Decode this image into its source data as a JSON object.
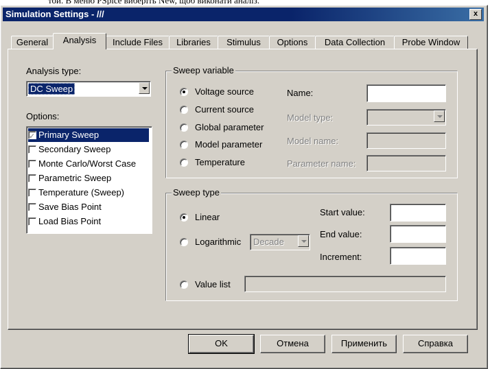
{
  "window": {
    "title": "Simulation Settings - ///",
    "close_label": "x"
  },
  "tabs": [
    {
      "label": "General"
    },
    {
      "label": "Analysis",
      "active": true
    },
    {
      "label": "Include Files"
    },
    {
      "label": "Libraries"
    },
    {
      "label": "Stimulus"
    },
    {
      "label": "Options"
    },
    {
      "label": "Data Collection"
    },
    {
      "label": "Probe Window"
    }
  ],
  "analysis_type": {
    "label": "Analysis type:",
    "value": "DC Sweep"
  },
  "options": {
    "label": "Options:",
    "items": [
      {
        "label": "Primary Sweep",
        "checked": true,
        "selected": true
      },
      {
        "label": "Secondary Sweep",
        "checked": false
      },
      {
        "label": "Monte Carlo/Worst Case",
        "checked": false
      },
      {
        "label": "Parametric Sweep",
        "checked": false
      },
      {
        "label": "Temperature (Sweep)",
        "checked": false
      },
      {
        "label": "Save Bias Point",
        "checked": false
      },
      {
        "label": "Load Bias Point",
        "checked": false
      }
    ]
  },
  "sweep_variable": {
    "title": "Sweep variable",
    "options": [
      {
        "label": "Voltage source",
        "checked": true
      },
      {
        "label": "Current source",
        "checked": false
      },
      {
        "label": "Global parameter",
        "checked": false
      },
      {
        "label": "Model parameter",
        "checked": false
      },
      {
        "label": "Temperature",
        "checked": false
      }
    ],
    "fields": {
      "name_label": "Name:",
      "model_type_label": "Model type:",
      "model_name_label": "Model name:",
      "parameter_name_label": "Parameter name:"
    }
  },
  "sweep_type": {
    "title": "Sweep type",
    "linear_label": "Linear",
    "logarithmic_label": "Logarithmic",
    "log_option": "Decade",
    "value_list_label": "Value list",
    "start_value_label": "Start value:",
    "end_value_label": "End value:",
    "increment_label": "Increment:"
  },
  "buttons": {
    "ok": "OK",
    "cancel": "Отмена",
    "apply": "Применить",
    "help": "Справка"
  }
}
